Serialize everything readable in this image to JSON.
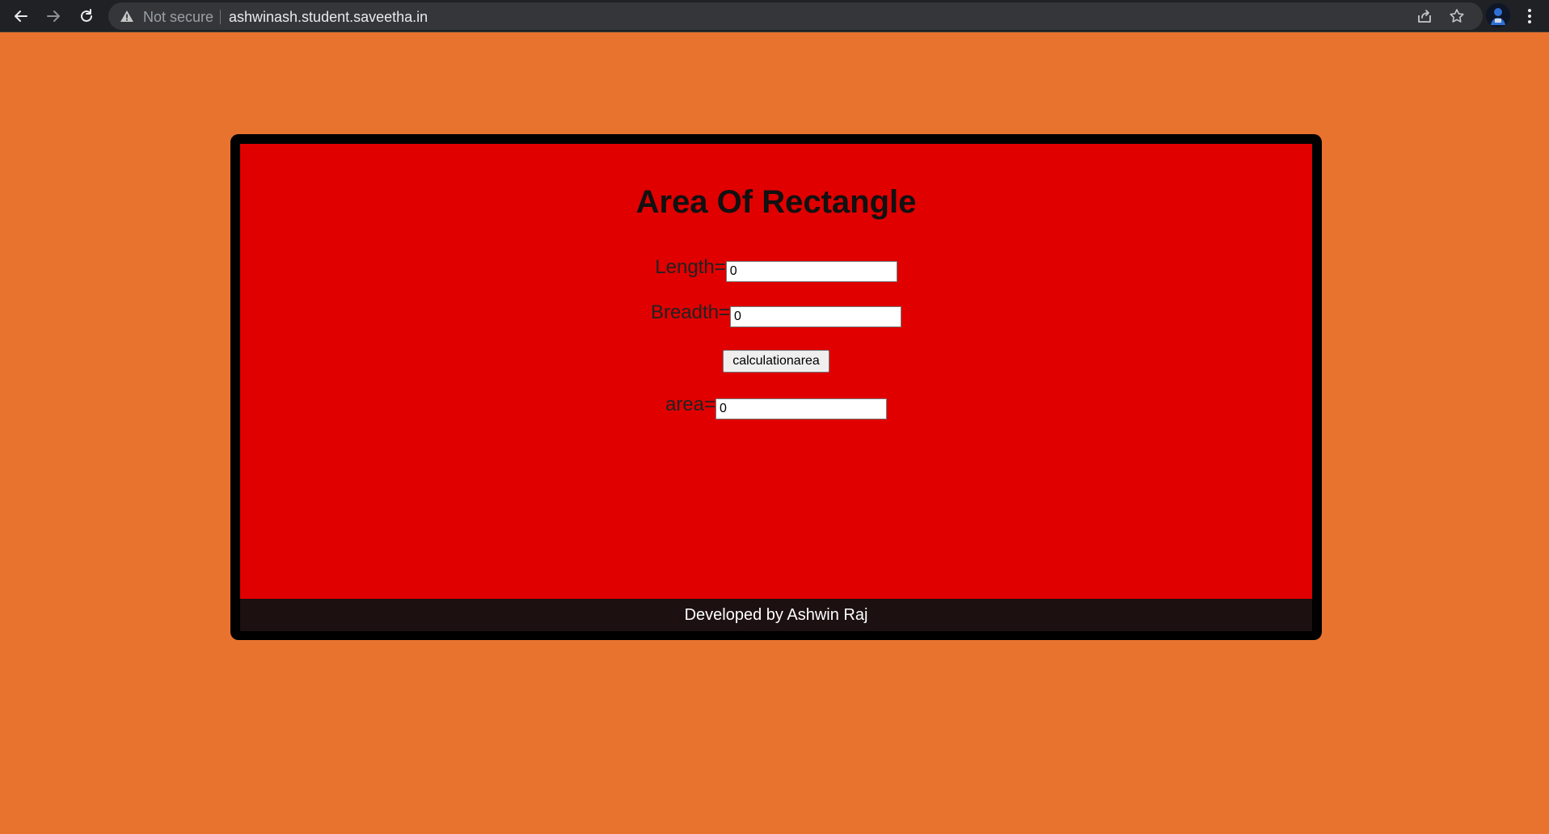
{
  "browser": {
    "not_secure_label": "Not secure",
    "url": "ashwinash.student.saveetha.in",
    "icons": [
      "back-arrow-icon",
      "forward-arrow-icon",
      "reload-icon",
      "warning-icon",
      "share-icon",
      "star-icon",
      "profile-avatar",
      "kebab-menu-icon"
    ]
  },
  "page": {
    "title": "Area Of Rectangle",
    "length_label": "Length=",
    "length_value": "0",
    "breadth_label": "Breadth=",
    "breadth_value": "0",
    "button_label": "calculationarea",
    "area_label": "area=",
    "area_value": "0",
    "footer_text": "Developed by Ashwin Raj"
  },
  "colors": {
    "background": "#e8732e",
    "panel": "#e00000",
    "frame": "#000000",
    "footer": "#1c1010",
    "chrome": "#202124"
  }
}
